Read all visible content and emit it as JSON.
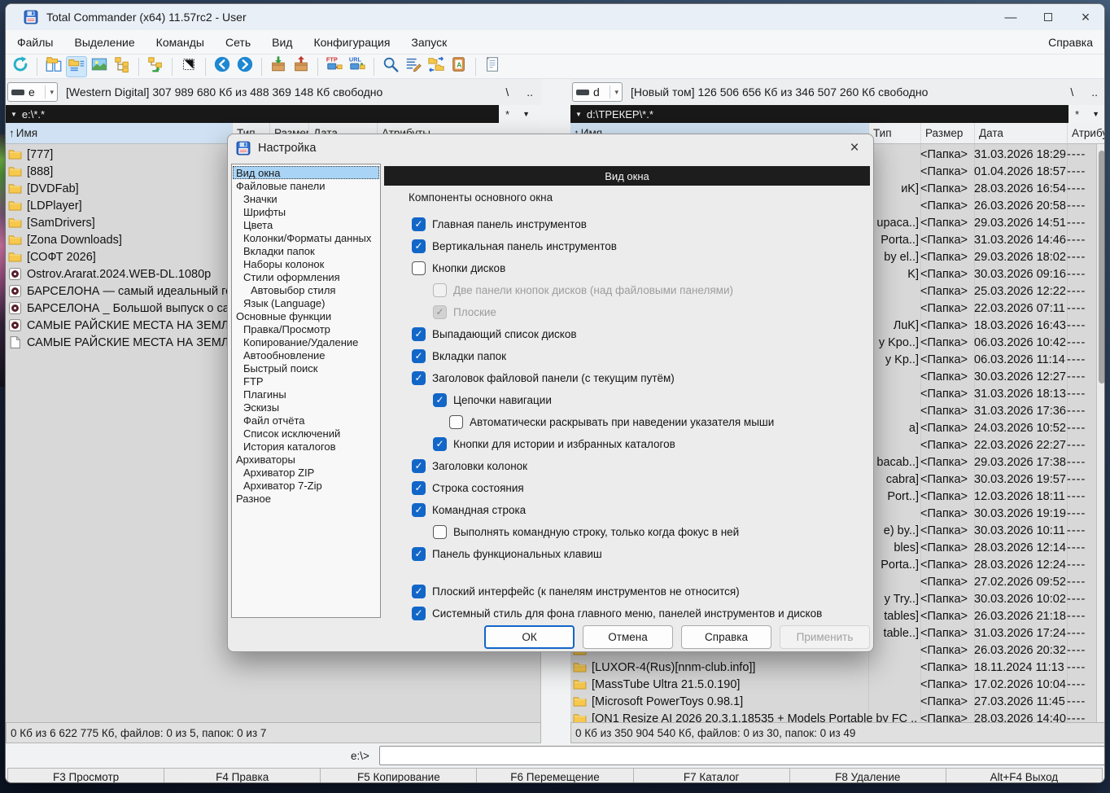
{
  "window": {
    "title": "Total Commander (x64) 11.57rc2 - User",
    "controls": {
      "minimize": "—",
      "close": "×"
    }
  },
  "menu": {
    "items": [
      "Файлы",
      "Выделение",
      "Команды",
      "Сеть",
      "Вид",
      "Конфигурация",
      "Запуск"
    ],
    "help": "Справка"
  },
  "toolbar": {
    "buttons": [
      {
        "icon": "refresh-icon"
      },
      {
        "sep": true
      },
      {
        "icon": "brief-view-icon"
      },
      {
        "icon": "full-view-icon",
        "selected": true
      },
      {
        "icon": "thumbnails-icon"
      },
      {
        "icon": "tree-view-icon"
      },
      {
        "sep": true
      },
      {
        "icon": "branch-view-icon"
      },
      {
        "sep": true
      },
      {
        "icon": "invert-selection-icon"
      },
      {
        "sep": true
      },
      {
        "icon": "back-icon"
      },
      {
        "icon": "forward-icon"
      },
      {
        "sep": true
      },
      {
        "icon": "pack-icon"
      },
      {
        "icon": "unpack-icon"
      },
      {
        "sep": true
      },
      {
        "icon": "ftp-connect-icon"
      },
      {
        "icon": "ftp-url-icon"
      },
      {
        "sep": true
      },
      {
        "icon": "search-icon"
      },
      {
        "icon": "multi-rename-icon"
      },
      {
        "icon": "sync-dirs-icon"
      },
      {
        "icon": "compare-contents-icon"
      },
      {
        "sep": true
      },
      {
        "icon": "notepad-icon"
      }
    ]
  },
  "left_panel": {
    "drive_letter": "e",
    "drive_info": "[Western Digital]  307 989 680 Кб из 488 369 148 Кб свободно",
    "root_button": "\\",
    "up_button": "..",
    "path": "e:\\*.*",
    "path_triangle": "▼",
    "star_button": "*",
    "menu_button": "▼",
    "sort_arrow": "↑",
    "columns": [
      "Имя",
      "Тип",
      "Размер",
      "Дата",
      "Атрибуты"
    ],
    "rows": [
      {
        "name": "[777]",
        "icon": "folder-icon"
      },
      {
        "name": "[888]",
        "icon": "folder-icon"
      },
      {
        "name": "[DVDFab]",
        "icon": "folder-icon"
      },
      {
        "name": "[LDPlayer]",
        "icon": "folder-icon"
      },
      {
        "name": "[SamDrivers]",
        "icon": "folder-icon"
      },
      {
        "name": "[Zona Downloads]",
        "icon": "folder-icon"
      },
      {
        "name": "[СОФТ 2026]",
        "icon": "folder-icon"
      },
      {
        "name": "Ostrov.Ararat.2024.WEB-DL.1080p",
        "icon": "media-file-icon"
      },
      {
        "name": "БАРСЕЛОНА — самый идеальный го",
        "icon": "media-file-icon"
      },
      {
        "name": "БАРСЕЛОНА _ Большой выпуск о са",
        "icon": "media-file-icon"
      },
      {
        "name": "САМЫЕ РАЙСКИЕ МЕСТА НА ЗЕМЛЕ",
        "icon": "media-file-icon"
      },
      {
        "name": "САМЫЕ РАЙСКИЕ МЕСТА НА ЗЕМЛЕ",
        "icon": "file-icon"
      }
    ],
    "status": "0 Кб из 6 622 775 Кб, файлов: 0 из 5, папок: 0 из 7"
  },
  "right_panel": {
    "drive_letter": "d",
    "drive_info": "[Новый том]  126 506 656 Кб из 346 507 260 Кб свободно",
    "root_button": "\\",
    "up_button": "..",
    "path": "d:\\ТРЕКЕР\\*.*",
    "path_triangle": "▼",
    "star_button": "*",
    "menu_button": "▼",
    "sort_arrow": "↑",
    "columns": [
      "Имя",
      "Тип",
      "Размер",
      "Дата",
      "Атрибуты"
    ],
    "size_label": "<Папка>",
    "attr_label": "----",
    "rows": [
      {
        "frag": "",
        "date": "31.03.2026 18:29"
      },
      {
        "frag": "",
        "date": "01.04.2026 18:57"
      },
      {
        "frag": "иK]",
        "date": "28.03.2026 16:54"
      },
      {
        "frag": "",
        "date": "26.03.2026 20:58"
      },
      {
        "frag": "upaca..]",
        "date": "29.03.2026 14:51"
      },
      {
        "frag": "Porta..]",
        "date": "31.03.2026 14:46"
      },
      {
        "frag": "by el..]",
        "date": "29.03.2026 18:02"
      },
      {
        "frag": "K]",
        "date": "30.03.2026 09:16"
      },
      {
        "frag": "",
        "date": "25.03.2026 12:22"
      },
      {
        "frag": "",
        "date": "22.03.2026 07:11"
      },
      {
        "frag": "ЛuK]",
        "date": "18.03.2026 16:43"
      },
      {
        "frag": "y Kpo..]",
        "date": "06.03.2026 10:42"
      },
      {
        "frag": "y Kp..]",
        "date": "06.03.2026 11:14"
      },
      {
        "frag": "",
        "date": "30.03.2026 12:27"
      },
      {
        "frag": "",
        "date": "31.03.2026 18:13"
      },
      {
        "frag": "",
        "date": "31.03.2026 17:36"
      },
      {
        "frag": "a]",
        "date": "24.03.2026 10:52"
      },
      {
        "frag": "",
        "date": "22.03.2026 22:27"
      },
      {
        "frag": "bacab..]",
        "date": "29.03.2026 17:38"
      },
      {
        "frag": "cabra]",
        "date": "30.03.2026 19:57"
      },
      {
        "frag": "Port..]",
        "date": "12.03.2026 18:11"
      },
      {
        "frag": "",
        "date": "30.03.2026 19:19"
      },
      {
        "frag": "e) by..]",
        "date": "30.03.2026 10:11"
      },
      {
        "frag": "bles]",
        "date": "28.03.2026 12:14"
      },
      {
        "frag": "Porta..]",
        "date": "28.03.2026 12:24"
      },
      {
        "frag": "",
        "date": "27.02.2026 09:52"
      },
      {
        "frag": "y Try..]",
        "date": "30.03.2026 10:02"
      },
      {
        "frag": "tables]",
        "date": "26.03.2026 21:18"
      },
      {
        "frag": "table..]",
        "date": "31.03.2026 17:24"
      },
      {
        "name": "",
        "icon": "folder-icon",
        "date": "26.03.2026 20:32"
      },
      {
        "name": "[LUXOR-4(Rus)[nnm-club.info]]",
        "icon": "folder-icon",
        "date": "18.11.2024 11:13"
      },
      {
        "name": "[MassTube Ultra 21.5.0.190]",
        "icon": "folder-icon",
        "date": "17.02.2026 10:04"
      },
      {
        "name": "[Microsoft PowerToys 0.98.1]",
        "icon": "folder-icon",
        "date": "27.03.2026 11:45"
      },
      {
        "name": "[ON1 Resize AI 2026 20.3.1.18535 + Models Portable by FC ..]",
        "icon": "folder-icon",
        "date": "28.03.2026 14:40"
      }
    ],
    "status": "0 Кб из 350 904 540 Кб, файлов: 0 из 30, папок: 0 из 49"
  },
  "dialog": {
    "title": "Настройка",
    "close": "×",
    "categories": [
      {
        "label": "Вид окна",
        "indent": 0,
        "selected": true
      },
      {
        "label": "Файловые панели",
        "indent": 0
      },
      {
        "label": "Значки",
        "indent": 1
      },
      {
        "label": "Шрифты",
        "indent": 1
      },
      {
        "label": "Цвета",
        "indent": 1
      },
      {
        "label": "Колонки/Форматы данных",
        "indent": 1
      },
      {
        "label": "Вкладки папок",
        "indent": 1
      },
      {
        "label": "Наборы колонок",
        "indent": 1
      },
      {
        "label": "Стили оформления",
        "indent": 1
      },
      {
        "label": "Автовыбор стиля",
        "indent": 2
      },
      {
        "label": "Язык (Language)",
        "indent": 1
      },
      {
        "label": "Основные функции",
        "indent": 0
      },
      {
        "label": "Правка/Просмотр",
        "indent": 1
      },
      {
        "label": "Копирование/Удаление",
        "indent": 1
      },
      {
        "label": "Автообновление",
        "indent": 1
      },
      {
        "label": "Быстрый поиск",
        "indent": 1
      },
      {
        "label": "FTP",
        "indent": 1
      },
      {
        "label": "Плагины",
        "indent": 1
      },
      {
        "label": "Эскизы",
        "indent": 1
      },
      {
        "label": "Файл отчёта",
        "indent": 1
      },
      {
        "label": "Список исключений",
        "indent": 1
      },
      {
        "label": "История каталогов",
        "indent": 1
      },
      {
        "label": "Архиваторы",
        "indent": 0
      },
      {
        "label": "Архиватор ZIP",
        "indent": 1
      },
      {
        "label": "Архиватор 7-Zip",
        "indent": 1
      },
      {
        "label": "Разное",
        "indent": 0
      }
    ],
    "panel_header": "Вид окна",
    "group_label": "Компоненты основного окна",
    "options": [
      {
        "label": "Главная панель инструментов",
        "checked": true,
        "indent": 0
      },
      {
        "label": "Вертикальная панель инструментов",
        "checked": true,
        "indent": 0
      },
      {
        "label": "Кнопки дисков",
        "checked": false,
        "indent": 0
      },
      {
        "label": "Две панели кнопок дисков (над файловыми панелями)",
        "checked": false,
        "indent": 1,
        "disabled": true
      },
      {
        "label": "Плоские",
        "checked": true,
        "indent": 1,
        "disabled": true
      },
      {
        "label": "Выпадающий список дисков",
        "checked": true,
        "indent": 0
      },
      {
        "label": "Вкладки папок",
        "checked": true,
        "indent": 0
      },
      {
        "label": "Заголовок файловой панели (с текущим путём)",
        "checked": true,
        "indent": 0
      },
      {
        "label": "Цепочки навигации",
        "checked": true,
        "indent": 1
      },
      {
        "label": "Автоматически раскрывать при наведении указателя мыши",
        "checked": false,
        "indent": 2
      },
      {
        "label": "Кнопки для истории и избранных каталогов",
        "checked": true,
        "indent": 1
      },
      {
        "label": "Заголовки колонок",
        "checked": true,
        "indent": 0
      },
      {
        "label": "Строка состояния",
        "checked": true,
        "indent": 0
      },
      {
        "label": "Командная строка",
        "checked": true,
        "indent": 0
      },
      {
        "label": "Выполнять командную строку, только когда фокус в ней",
        "checked": false,
        "indent": 1
      },
      {
        "label": "Панель функциональных клавиш",
        "checked": true,
        "indent": 0
      },
      {
        "spacer": true
      },
      {
        "label": "Плоский интерфейс (к панелям инструментов не относится)",
        "checked": true,
        "indent": 0
      },
      {
        "label": "Системный стиль для фона главного меню, панелей инструментов и дисков",
        "checked": true,
        "indent": 0
      }
    ],
    "buttons": [
      {
        "label": "ОК",
        "style": "default"
      },
      {
        "label": "Отмена"
      },
      {
        "label": "Справка"
      },
      {
        "label": "Применить",
        "disabled": true
      }
    ]
  },
  "command_line": {
    "prompt": "e:\\>",
    "value": ""
  },
  "function_bar": [
    "F3 Просмотр",
    "F4 Правка",
    "F5 Копирование",
    "F6 Перемещение",
    "F7 Каталог",
    "F8 Удаление",
    "Alt+F4 Выход"
  ]
}
